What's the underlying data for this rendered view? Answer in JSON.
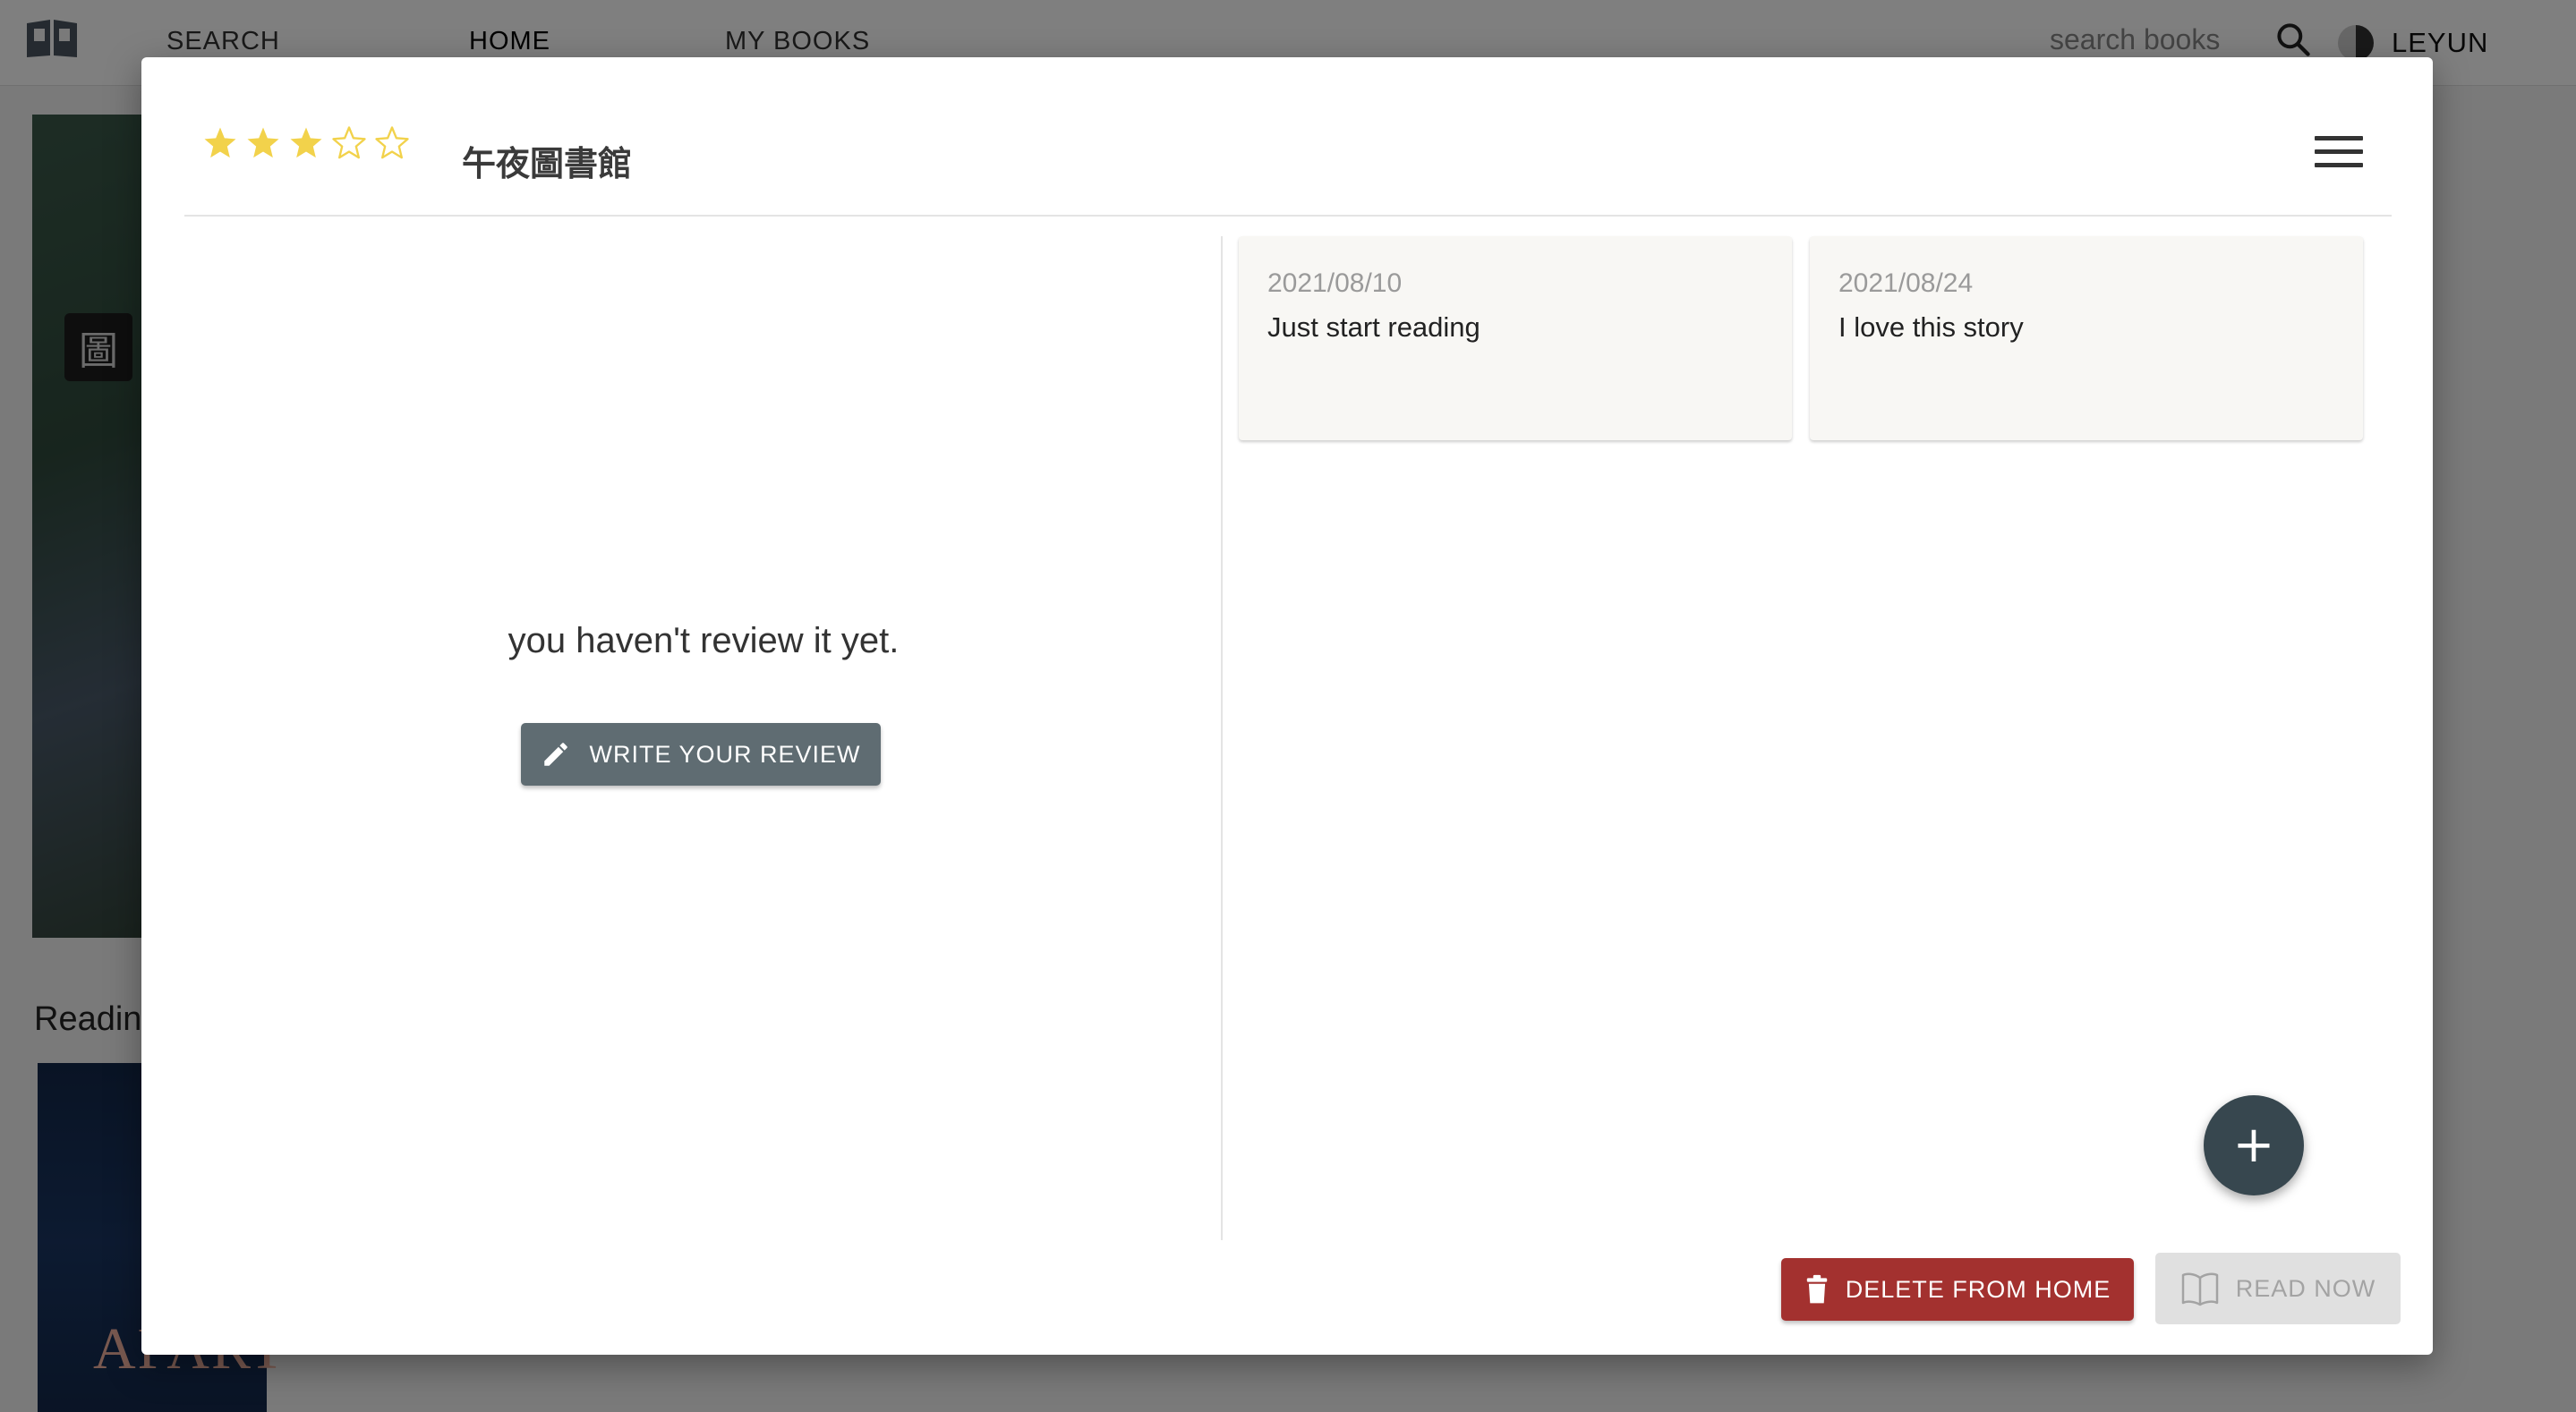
{
  "topbar": {
    "nav": {
      "search": "SEARCH",
      "home": "HOME",
      "my_books": "MY BOOKS"
    },
    "search_placeholder": "search books",
    "username": "LEYUN"
  },
  "background": {
    "section_title": "Readin",
    "cover_badge_char": "圖",
    "cover2_text": "APART"
  },
  "modal": {
    "rating": 3,
    "max_rating": 5,
    "star_color": "#f2d24b",
    "book_title": "午夜圖書館",
    "review": {
      "empty_text": "you haven't review it yet.",
      "write_button": "WRITE YOUR REVIEW"
    },
    "notes": [
      {
        "date": "2021/08/10",
        "text": "Just start reading"
      },
      {
        "date": "2021/08/24",
        "text": "I love this story"
      }
    ],
    "fab_label": "+",
    "delete_button": "DELETE FROM HOME",
    "read_button": "READ NOW",
    "colors": {
      "delete": "#a3312f",
      "primary": "#37474f",
      "write_btn": "#5f6c72"
    }
  }
}
